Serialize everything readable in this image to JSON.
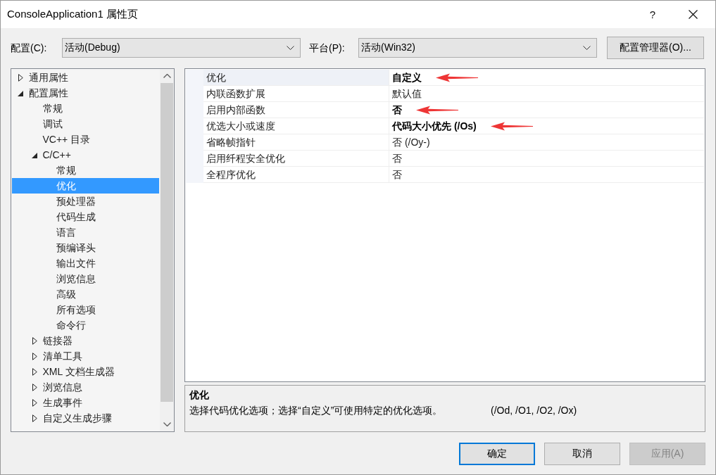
{
  "window": {
    "title": "ConsoleApplication1 属性页",
    "help": "?"
  },
  "toolbar": {
    "configuration": {
      "label": "配置(C):",
      "value": "活动(Debug)"
    },
    "platform": {
      "label": "平台(P):",
      "value": "活动(Win32)"
    },
    "manager_button": "配置管理器(O)..."
  },
  "tree": {
    "items": [
      {
        "label": "通用属性",
        "kind": "group",
        "expanded": false,
        "selected": false
      },
      {
        "label": "配置属性",
        "kind": "group",
        "expanded": true,
        "selected": false,
        "children": [
          {
            "label": "常规",
            "kind": "page",
            "selected": false
          },
          {
            "label": "调试",
            "kind": "page",
            "selected": false
          },
          {
            "label": "VC++ 目录",
            "kind": "page",
            "selected": false
          },
          {
            "label": "C/C++",
            "kind": "group",
            "expanded": true,
            "selected": false,
            "children": [
              {
                "label": "常规",
                "kind": "page",
                "selected": false
              },
              {
                "label": "优化",
                "kind": "page",
                "selected": true
              },
              {
                "label": "预处理器",
                "kind": "page",
                "selected": false
              },
              {
                "label": "代码生成",
                "kind": "page",
                "selected": false
              },
              {
                "label": "语言",
                "kind": "page",
                "selected": false
              },
              {
                "label": "预编译头",
                "kind": "page",
                "selected": false
              },
              {
                "label": "输出文件",
                "kind": "page",
                "selected": false
              },
              {
                "label": "浏览信息",
                "kind": "page",
                "selected": false
              },
              {
                "label": "高级",
                "kind": "page",
                "selected": false
              },
              {
                "label": "所有选项",
                "kind": "page",
                "selected": false
              },
              {
                "label": "命令行",
                "kind": "page",
                "selected": false
              }
            ]
          },
          {
            "label": "链接器",
            "kind": "group",
            "expanded": false,
            "selected": false
          },
          {
            "label": "清单工具",
            "kind": "group",
            "expanded": false,
            "selected": false
          },
          {
            "label": "XML 文档生成器",
            "kind": "group",
            "expanded": false,
            "selected": false
          },
          {
            "label": "浏览信息",
            "kind": "group",
            "expanded": false,
            "selected": false
          },
          {
            "label": "生成事件",
            "kind": "group",
            "expanded": false,
            "selected": false
          },
          {
            "label": "自定义生成步骤",
            "kind": "group",
            "expanded": false,
            "selected": false
          }
        ]
      }
    ]
  },
  "grid": {
    "rows": [
      {
        "name": "优化",
        "value": "自定义",
        "selected": true,
        "modified": true,
        "arrow": true
      },
      {
        "name": "内联函数扩展",
        "value": "默认值",
        "selected": false,
        "modified": false,
        "arrow": false
      },
      {
        "name": "启用内部函数",
        "value": "否",
        "selected": false,
        "modified": true,
        "arrow": true
      },
      {
        "name": "优选大小或速度",
        "value": "代码大小优先 (/Os)",
        "selected": false,
        "modified": true,
        "arrow": true
      },
      {
        "name": "省略帧指针",
        "value": "否 (/Oy-)",
        "selected": false,
        "modified": false,
        "arrow": false
      },
      {
        "name": "启用纤程安全优化",
        "value": "否",
        "selected": false,
        "modified": false,
        "arrow": false
      },
      {
        "name": "全程序优化",
        "value": "否",
        "selected": false,
        "modified": false,
        "arrow": false
      }
    ]
  },
  "description": {
    "title": "优化",
    "text": "选择代码优化选项；选择“自定义”可使用特定的优化选项。",
    "switches": "(/Od, /O1, /O2, /Ox)"
  },
  "buttons": [
    {
      "label": "确定",
      "default": true,
      "disabled": false
    },
    {
      "label": "取消",
      "default": false,
      "disabled": false
    },
    {
      "label": "应用(A)",
      "default": false,
      "disabled": true
    }
  ]
}
